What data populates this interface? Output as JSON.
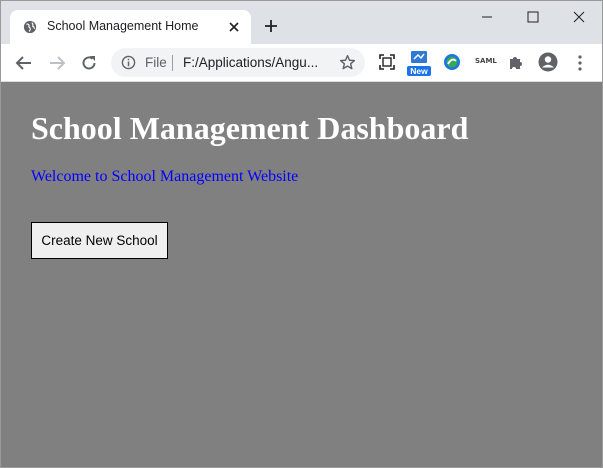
{
  "browser": {
    "tab": {
      "title": "School Management Home"
    },
    "address_bar": {
      "scheme_label": "File",
      "url": "F:/Applications/Angu..."
    },
    "extension_badge": "New",
    "extension_text": "SAML"
  },
  "page": {
    "title": "School Management Dashboard",
    "welcome": "Welcome to School Management Website",
    "create_button_label": "Create New School"
  },
  "colors": {
    "page_background": "#808080",
    "title_text": "#ffffff",
    "welcome_text": "#0000ff",
    "button_background": "#efefef"
  }
}
